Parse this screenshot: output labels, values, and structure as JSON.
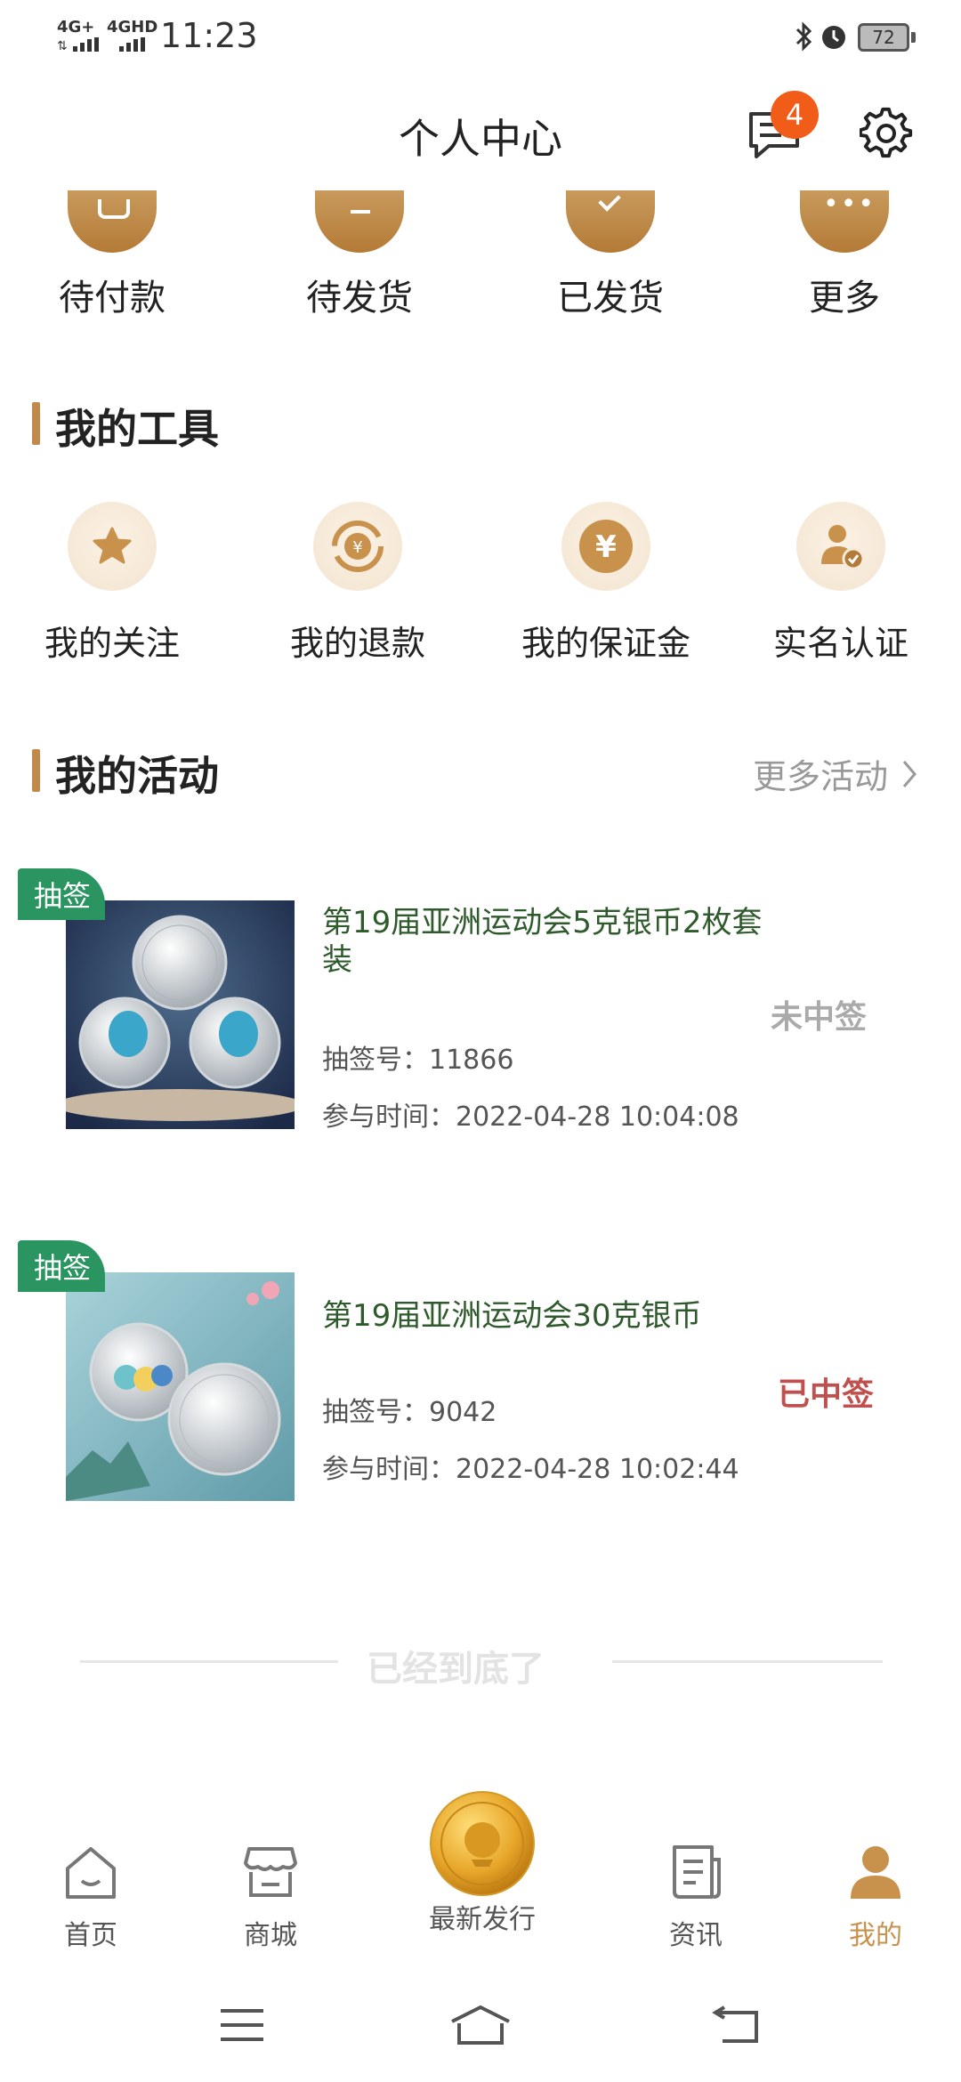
{
  "status_bar": {
    "signal1": "4G+",
    "signal2": "4GHD",
    "time": "11:23",
    "battery": "72"
  },
  "header": {
    "title": "个人中心",
    "message_badge": "4"
  },
  "orders": [
    {
      "label": "待付款",
      "icon": "wallet-icon"
    },
    {
      "label": "待发货",
      "icon": "box-icon"
    },
    {
      "label": "已发货",
      "icon": "shipped-icon"
    },
    {
      "label": "更多",
      "icon": "more-icon"
    }
  ],
  "tools": {
    "title": "我的工具",
    "items": [
      {
        "label": "我的关注",
        "icon": "star-icon"
      },
      {
        "label": "我的退款",
        "icon": "refund-icon"
      },
      {
        "label": "我的保证金",
        "icon": "yen-icon"
      },
      {
        "label": "实名认证",
        "icon": "verified-user-icon"
      }
    ]
  },
  "activities": {
    "title": "我的活动",
    "more": "更多活动",
    "items": [
      {
        "tag": "抽签",
        "title": "第19届亚洲运动会5克银币2枚套装",
        "lottery_no": "抽签号：11866",
        "time": "参与时间：2022-04-28 10:04:08",
        "result": "未中签",
        "result_color": "#aaaaaa"
      },
      {
        "tag": "抽签",
        "title": "第19届亚洲运动会30克银币",
        "lottery_no": "抽签号：9042",
        "time": "参与时间：2022-04-28 10:02:44",
        "result": "已中签",
        "result_color": "#c0504d"
      }
    ]
  },
  "end_text": "已经到底了",
  "bottom_nav": [
    {
      "label": "首页",
      "icon": "home-icon"
    },
    {
      "label": "商城",
      "icon": "store-icon"
    },
    {
      "label": "最新发行",
      "icon": "coin-icon"
    },
    {
      "label": "资讯",
      "icon": "news-icon"
    },
    {
      "label": "我的",
      "icon": "user-icon",
      "active": true
    }
  ],
  "colors": {
    "accent": "#c08a4a",
    "tag_green": "#2a9560",
    "badge": "#f25c19"
  }
}
